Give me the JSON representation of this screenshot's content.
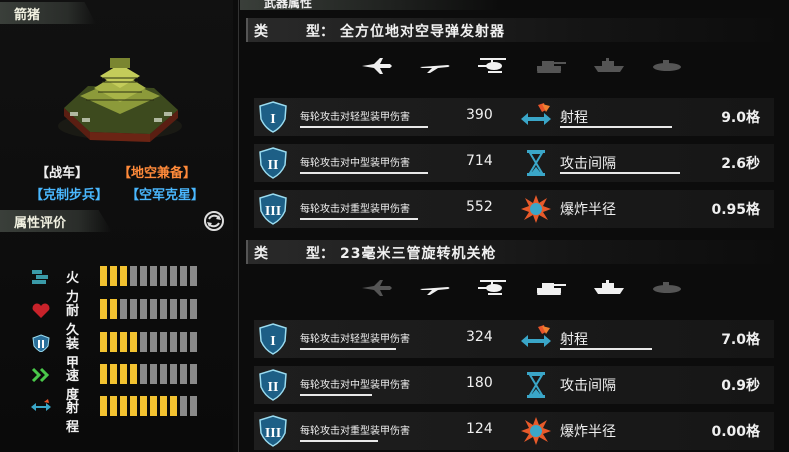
{
  "unit": {
    "name": "箭猪",
    "category_tag": "【战车】",
    "ability_tag": "【地空兼备】",
    "counter_tag": "【克制步兵】",
    "countered_by_tag": "【空军克星】",
    "colors": {
      "category": "#f0f0f0",
      "ability": "#ff8a3a",
      "counter": "#4ab8ff",
      "countered": "#4ab8ff"
    }
  },
  "rating": {
    "title": "属性评价",
    "items": [
      {
        "label": "火力",
        "icon": "firepower-icon",
        "level": 3,
        "max": 10
      },
      {
        "label": "耐久",
        "icon": "heart-icon",
        "level": 2,
        "max": 10
      },
      {
        "label": "装甲",
        "icon": "armor-shield-icon",
        "level": 4,
        "max": 10
      },
      {
        "label": "速度",
        "icon": "speed-chevrons-icon",
        "level": 4,
        "max": 10
      },
      {
        "label": "射程",
        "icon": "range-arrows-icon",
        "level": 8,
        "max": 10
      }
    ]
  },
  "weapons_panel": {
    "title": "武器属性",
    "weapons": [
      {
        "type_key": "类",
        "type_key2": "型：",
        "type_value": "全方位地对空导弹发射器",
        "targets": [
          {
            "icon": "fighter-jet-icon",
            "active": true
          },
          {
            "icon": "plane-icon",
            "active": true
          },
          {
            "icon": "helicopter-icon",
            "active": true
          },
          {
            "icon": "tank-icon",
            "active": false
          },
          {
            "icon": "ship-icon",
            "active": false
          },
          {
            "icon": "submarine-icon",
            "active": false
          }
        ],
        "damage": [
          {
            "label": "每轮攻击对轻型装甲伤害",
            "value": "390",
            "shield": "I"
          },
          {
            "label": "每轮攻击对中型装甲伤害",
            "value": "714",
            "shield": "II"
          },
          {
            "label": "每轮攻击对重型装甲伤害",
            "value": "552",
            "shield": "III"
          }
        ],
        "stats": [
          {
            "label": "射程",
            "value": "9.0格",
            "icon": "range-icon"
          },
          {
            "label": "攻击间隔",
            "value": "2.6秒",
            "icon": "hourglass-icon"
          },
          {
            "label": "爆炸半径",
            "value": "0.95格",
            "icon": "explosion-icon"
          }
        ]
      },
      {
        "type_key": "类",
        "type_key2": "型：",
        "type_value": "23毫米三管旋转机关枪",
        "targets": [
          {
            "icon": "fighter-jet-icon",
            "active": false
          },
          {
            "icon": "plane-icon",
            "active": true
          },
          {
            "icon": "helicopter-icon",
            "active": true
          },
          {
            "icon": "tank-icon",
            "active": true
          },
          {
            "icon": "ship-icon",
            "active": true
          },
          {
            "icon": "submarine-icon",
            "active": false
          }
        ],
        "damage": [
          {
            "label": "每轮攻击对轻型装甲伤害",
            "value": "324",
            "shield": "I"
          },
          {
            "label": "每轮攻击对中型装甲伤害",
            "value": "180",
            "shield": "II"
          },
          {
            "label": "每轮攻击对重型装甲伤害",
            "value": "124",
            "shield": "III"
          }
        ],
        "stats": [
          {
            "label": "射程",
            "value": "7.0格",
            "icon": "range-icon"
          },
          {
            "label": "攻击间隔",
            "value": "0.9秒",
            "icon": "hourglass-icon"
          },
          {
            "label": "爆炸半径",
            "value": "0.00格",
            "icon": "explosion-icon"
          }
        ]
      }
    ]
  }
}
